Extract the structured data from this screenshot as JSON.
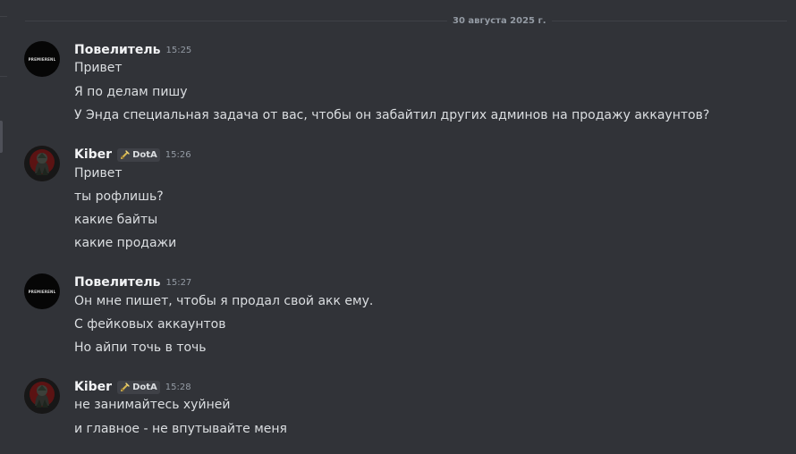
{
  "date_divider": {
    "label": "30 августа 2025 г."
  },
  "messages": [
    {
      "username": "Повелитель",
      "time": "15:25",
      "avatar": "black-logo-avatar",
      "avatar_text": "PREMIERENL",
      "lines": [
        "Привет",
        "Я по делам пишу",
        "У Энда специальная задача от вас, чтобы он забайтил других админов на продажу аккаунтов?"
      ]
    },
    {
      "username": "Kiber",
      "time": "15:26",
      "avatar": "dark-red-character-avatar",
      "badge": {
        "label": "DotA",
        "icon": "sword-icon",
        "color": "#d7b84f"
      },
      "lines": [
        "Привет",
        "ты рофлишь?",
        "какие байты",
        "какие продажи"
      ]
    },
    {
      "username": "Повелитель",
      "time": "15:27",
      "avatar": "black-logo-avatar",
      "avatar_text": "PREMIERENL",
      "lines": [
        "Он мне пишет, чтобы я продал свой акк ему.",
        "С фейковых аккаунтов",
        "Но айпи точь в точь"
      ]
    },
    {
      "username": "Kiber",
      "time": "15:28",
      "avatar": "dark-red-character-avatar",
      "badge": {
        "label": "DotA",
        "icon": "sword-icon",
        "color": "#d7b84f"
      },
      "lines": [
        "не занимайтесь хуйней",
        "и главное - не впутывайте меня"
      ]
    }
  ],
  "colors": {
    "background": "#313338",
    "text": "#dbdee1",
    "username": "#f2f3f5",
    "muted": "#949ba4",
    "divider": "#3f4147"
  }
}
